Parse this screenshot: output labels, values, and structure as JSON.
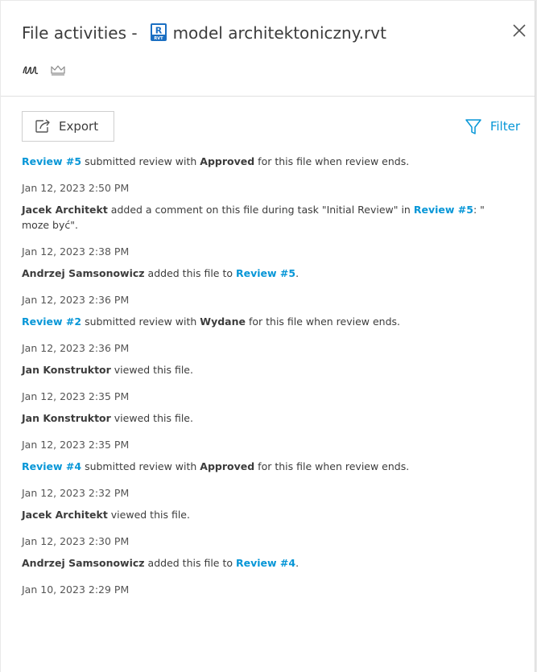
{
  "header": {
    "title_prefix": "File activities -",
    "file_name": "model architektoniczny.rvt",
    "file_icon_label": "R",
    "file_icon_sublabel": "RVT"
  },
  "toolbar": {
    "export_label": "Export",
    "filter_label": "Filter"
  },
  "activities": [
    {
      "link1": "Review #5",
      "t1": " submitted review with ",
      "bold": "Approved",
      "t2": " for this file when review ends."
    },
    {
      "timestamp": "Jan 12, 2023 2:50 PM",
      "actor": "Jacek Architekt",
      "t1": " added a comment on this file during task \"Initial Review\" in ",
      "link1": "Review #5",
      "t2": ": \"",
      "line2": "moze być\"."
    },
    {
      "timestamp": "Jan 12, 2023 2:38 PM",
      "actor": "Andrzej Samsonowicz",
      "t1": " added this file to ",
      "link1": "Review #5",
      "t2": "."
    },
    {
      "timestamp": "Jan 12, 2023 2:36 PM",
      "link1": "Review #2",
      "t1": " submitted review with ",
      "bold": "Wydane",
      "t2": " for this file when review ends."
    },
    {
      "timestamp": "Jan 12, 2023 2:36 PM",
      "actor": "Jan Konstruktor",
      "t1": " viewed this file."
    },
    {
      "timestamp": "Jan 12, 2023 2:35 PM",
      "actor": "Jan Konstruktor",
      "t1": " viewed this file."
    },
    {
      "timestamp": "Jan 12, 2023 2:35 PM",
      "link1": "Review #4",
      "t1": " submitted review with ",
      "bold": "Approved",
      "t2": " for this file when review ends."
    },
    {
      "timestamp": "Jan 12, 2023 2:32 PM",
      "actor": "Jacek Architekt",
      "t1": " viewed this file."
    },
    {
      "timestamp": "Jan 12, 2023 2:30 PM",
      "actor": "Andrzej Samsonowicz",
      "t1": " added this file to ",
      "link1": "Review #4",
      "t2": "."
    },
    {
      "timestamp": "Jan 10, 2023 2:29 PM"
    }
  ],
  "colors": {
    "accent": "#0696d7",
    "text": "#3c3c3c",
    "rvt_icon": "#1b6fc2"
  },
  "icons": [
    "rvt-file-icon",
    "close-icon",
    "signature-icon",
    "crown-icon",
    "export-icon",
    "filter-icon"
  ]
}
